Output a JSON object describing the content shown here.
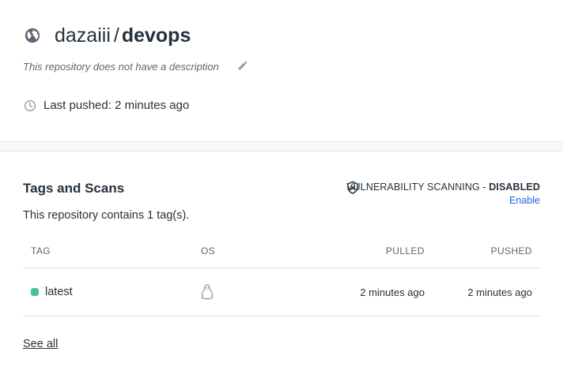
{
  "repo": {
    "owner": "dazaiii",
    "separator": "/",
    "name": "devops",
    "description": "This repository does not have a description",
    "last_pushed": "Last pushed: 2 minutes ago"
  },
  "tags_section": {
    "title": "Tags and Scans",
    "vuln_label": "VULNERABILITY SCANNING - ",
    "vuln_status": "DISABLED",
    "enable_link": "Enable",
    "count_text": "This repository contains 1 tag(s).",
    "columns": {
      "tag": "TAG",
      "os": "OS",
      "pulled": "PULLED",
      "pushed": "PUSHED"
    },
    "rows": [
      {
        "tag": "latest",
        "os_icon": "linux-icon",
        "pulled": "2 minutes ago",
        "pushed": "2 minutes ago",
        "status_color": "#48c0a0"
      }
    ],
    "see_all": "See all"
  },
  "colors": {
    "accent": "#1d63ed",
    "text": "#27313b",
    "muted": "#5b6773",
    "status_green": "#48c0a0"
  }
}
